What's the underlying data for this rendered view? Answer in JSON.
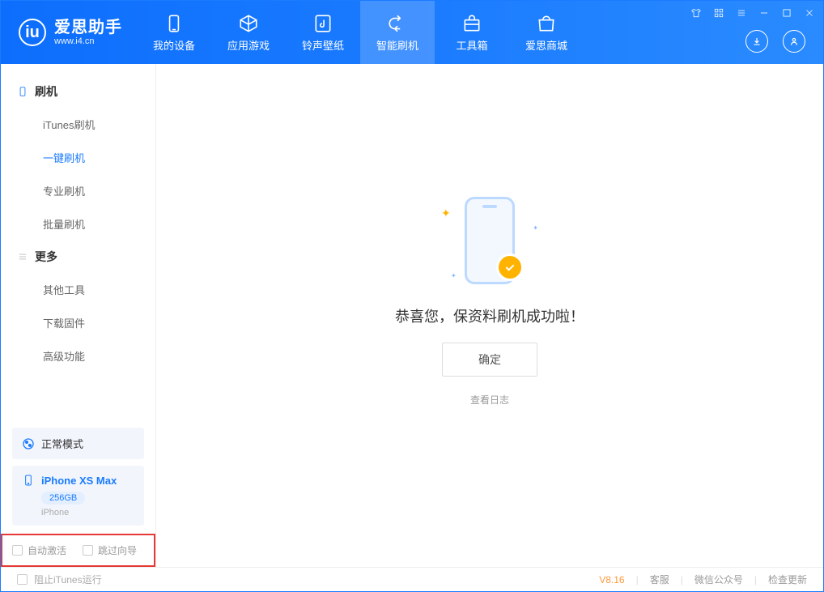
{
  "app": {
    "name": "爱思助手",
    "url": "www.i4.cn"
  },
  "nav": {
    "device": "我的设备",
    "apps": "应用游戏",
    "ringtone": "铃声壁纸",
    "flash": "智能刷机",
    "toolbox": "工具箱",
    "store": "爱思商城"
  },
  "sidebar": {
    "group_flash": "刷机",
    "items_flash": {
      "itunes": "iTunes刷机",
      "oneclick": "一键刷机",
      "pro": "专业刷机",
      "batch": "批量刷机"
    },
    "group_more": "更多",
    "items_more": {
      "other_tools": "其他工具",
      "download_fw": "下载固件",
      "advanced": "高级功能"
    }
  },
  "mode": {
    "label": "正常模式"
  },
  "device": {
    "name": "iPhone XS Max",
    "storage": "256GB",
    "type": "iPhone"
  },
  "options": {
    "auto_activate": "自动激活",
    "skip_guide": "跳过向导"
  },
  "main": {
    "success": "恭喜您，保资料刷机成功啦！",
    "confirm": "确定",
    "view_log": "查看日志"
  },
  "footer": {
    "block_itunes": "阻止iTunes运行",
    "version": "V8.16",
    "support": "客服",
    "wechat": "微信公众号",
    "update": "检查更新"
  }
}
